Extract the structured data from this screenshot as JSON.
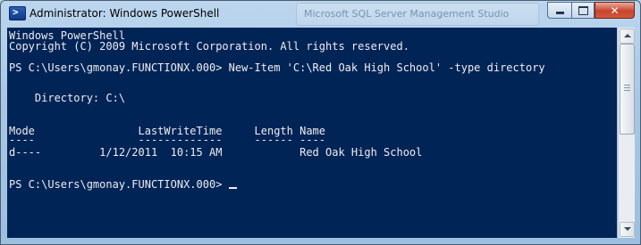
{
  "window": {
    "title": "Administrator: Windows PowerShell"
  },
  "background_app": {
    "title": "Microsoft SQL Server Management Studio"
  },
  "icons": {
    "app": "powershell-icon",
    "minimize": "minimize-icon",
    "maximize": "maximize-icon",
    "close": "close-icon"
  },
  "colors": {
    "console_bg": "#012456",
    "console_fg": "#eeedf0",
    "close_button": "#c8452c"
  },
  "console": {
    "header_line1": "Windows PowerShell",
    "header_line2": "Copyright (C) 2009 Microsoft Corporation. All rights reserved.",
    "command_line": "PS C:\\Users\\gmonay.FUNCTIONX.000> New-Item 'C:\\Red Oak High School' -type directory",
    "directory_line": "    Directory: C:\\",
    "table_header": "Mode                LastWriteTime     Length Name",
    "table_rule": "----                -------------     ------ ----",
    "table_row": "d----         1/12/2011  10:15 AM            Red Oak High School",
    "prompt": "PS C:\\Users\\gmonay.FUNCTIONX.000> "
  }
}
